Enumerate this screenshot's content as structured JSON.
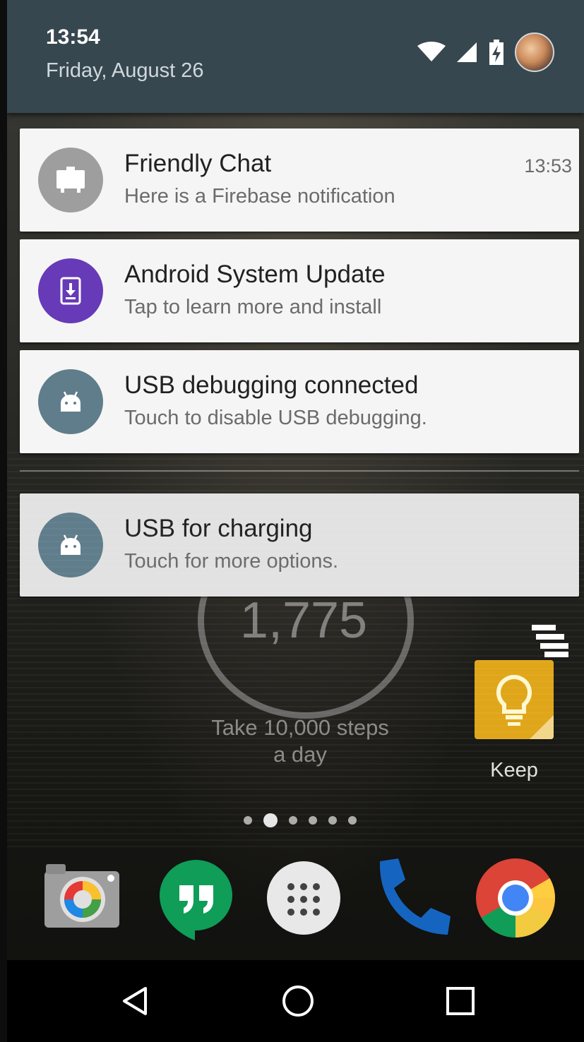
{
  "status": {
    "time": "13:54",
    "date": "Friday, August 26",
    "icons": [
      "wifi-icon",
      "cell-signal-icon",
      "battery-charging-icon",
      "user-avatar"
    ]
  },
  "notifications": [
    {
      "app_icon": "cast-icon",
      "icon_color": "#9e9e9e",
      "title": "Friendly Chat",
      "text": "Here is a Firebase notification",
      "time": "13:53"
    },
    {
      "app_icon": "system-update-icon",
      "icon_color": "#673ab7",
      "title": "Android System Update",
      "text": "Tap to learn more and install"
    },
    {
      "app_icon": "android-icon",
      "icon_color": "#607d8b",
      "title": "USB debugging connected",
      "text": "Touch to disable USB debugging."
    },
    {
      "app_icon": "android-icon",
      "icon_color": "#607d8b",
      "title": "USB for charging",
      "text": "Touch for more options."
    }
  ],
  "widget": {
    "steps": "1,775",
    "caption_line1": "Take 10,000 steps",
    "caption_line2": "a day"
  },
  "home": {
    "keep_label": "Keep",
    "page_count": 6,
    "active_page": 2
  },
  "dock": [
    "camera-icon",
    "hangouts-icon",
    "app-drawer-icon",
    "phone-icon",
    "chrome-icon"
  ],
  "nav": [
    "back-button",
    "home-button",
    "recents-button"
  ]
}
